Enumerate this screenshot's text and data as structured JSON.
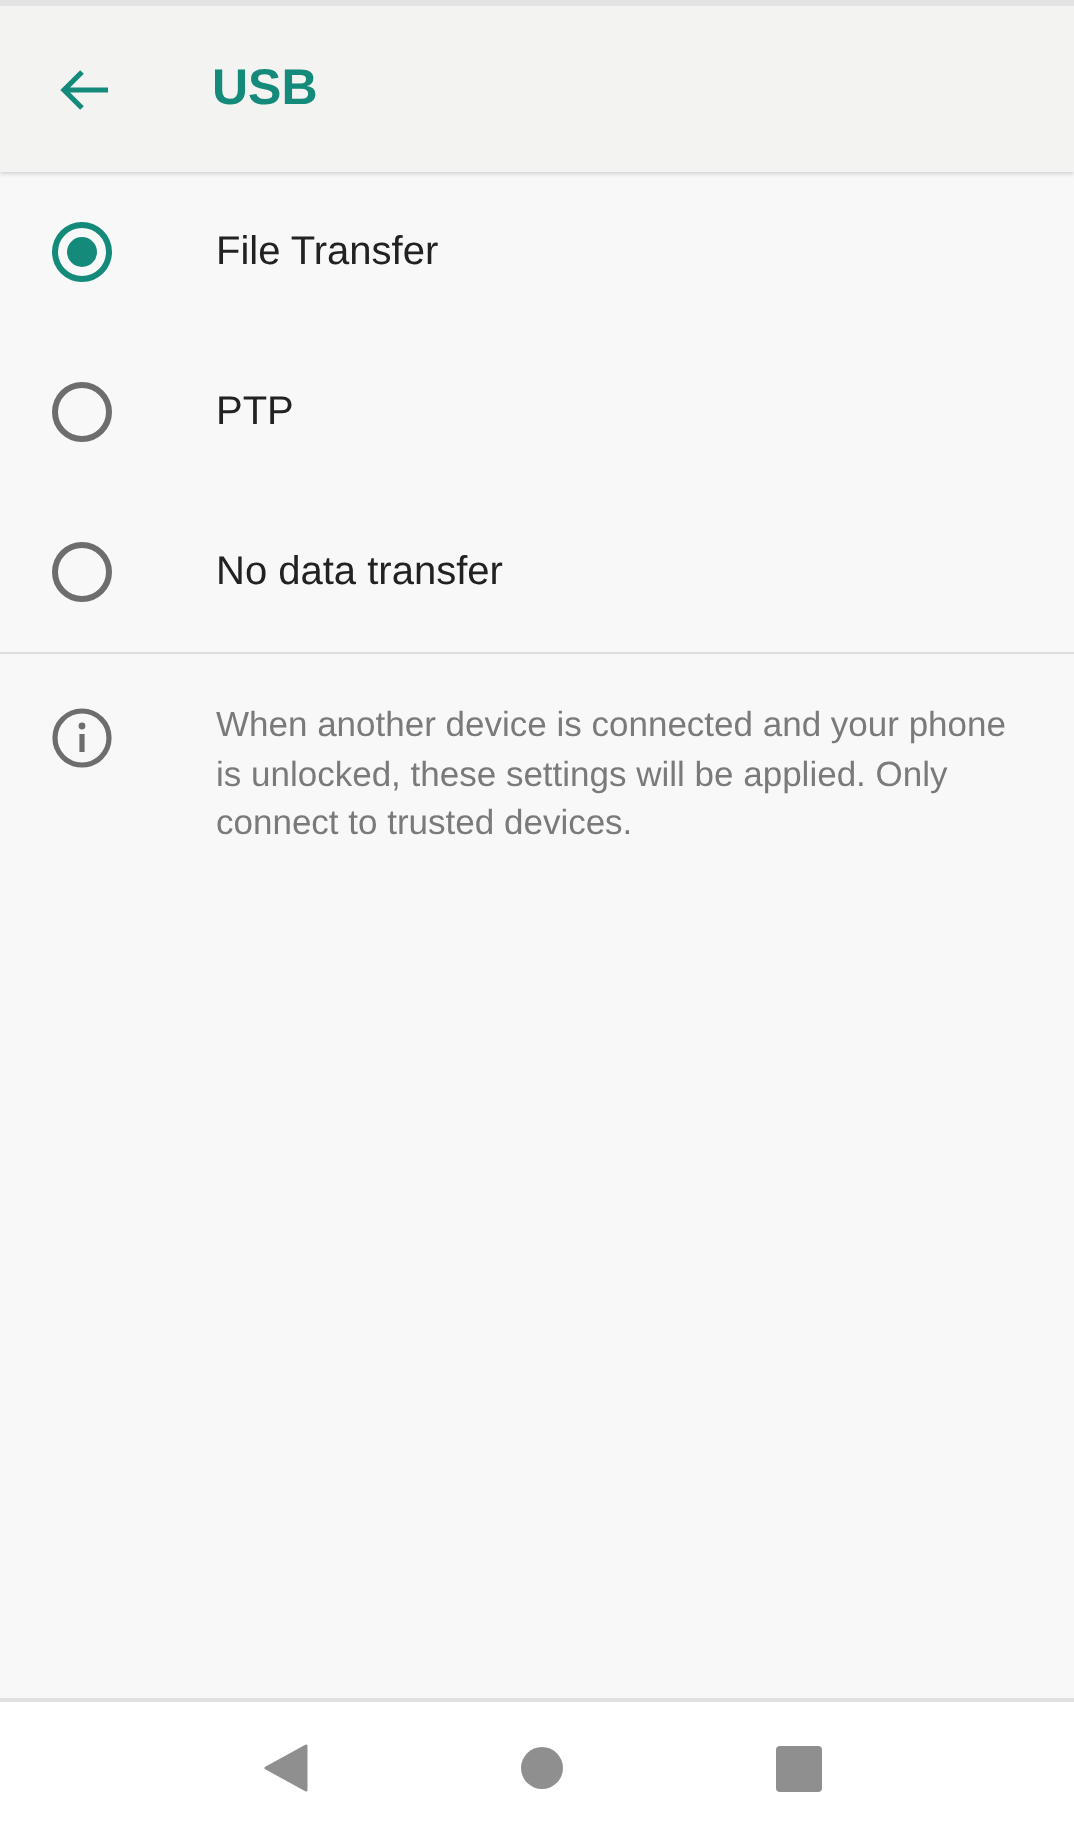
{
  "app_bar": {
    "title": "USB"
  },
  "options": [
    {
      "label": "File Transfer",
      "selected": true
    },
    {
      "label": "PTP",
      "selected": false
    },
    {
      "label": "No data transfer",
      "selected": false
    }
  ],
  "info": {
    "text": "When another device is connected and your phone is unlocked, these settings will be applied. Only connect to trusted devices."
  }
}
